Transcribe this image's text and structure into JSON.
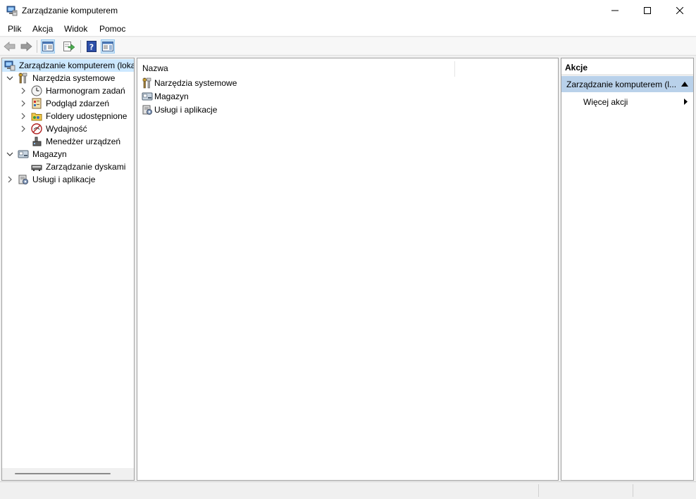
{
  "window": {
    "title": "Zarządzanie komputerem"
  },
  "menu": [
    "Plik",
    "Akcja",
    "Widok",
    "Pomoc"
  ],
  "tree": {
    "root": "Zarządzanie komputerem (loka",
    "items": [
      "Narzędzia systemowe",
      "Harmonogram zadań",
      "Podgląd zdarzeń",
      "Foldery udostępnione",
      "Wydajność",
      "Menedżer urządzeń",
      "Magazyn",
      "Zarządzanie dyskami",
      "Usługi i aplikacje"
    ]
  },
  "list": {
    "column_name": "Nazwa",
    "items": [
      "Narzędzia systemowe",
      "Magazyn",
      "Usługi i aplikacje"
    ]
  },
  "actions": {
    "header": "Akcje",
    "section": "Zarządzanie komputerem (l...",
    "more": "Więcej akcji"
  },
  "icons": {
    "app": "computer-management-icon",
    "back": "back-arrow-icon",
    "forward": "forward-arrow-icon",
    "console_tree": "console-tree-icon",
    "export": "export-list-icon",
    "help": "help-icon",
    "action_pane": "action-pane-icon"
  },
  "colors": {
    "selection": "#cce8ff",
    "action_section": "#b9d1ea"
  }
}
